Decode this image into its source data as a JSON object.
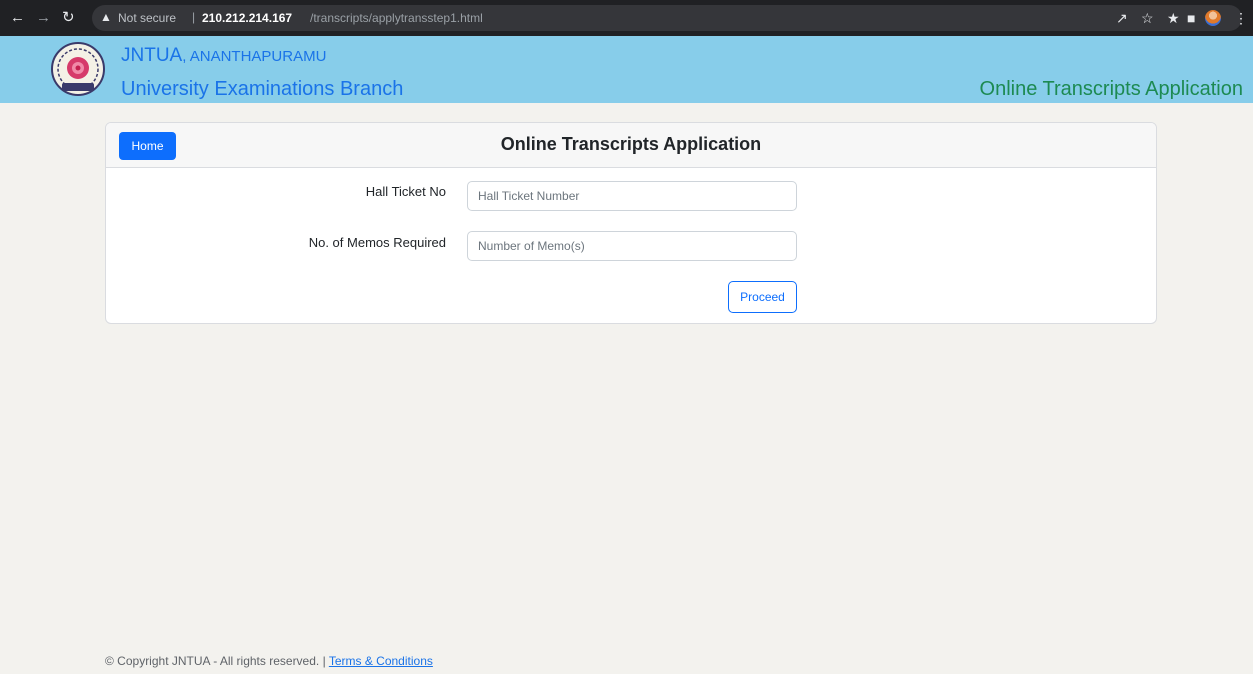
{
  "browser": {
    "not_secure": "Not secure",
    "separator": "|",
    "host": "210.212.214.167",
    "path": "/transcripts/applytransstep1.html"
  },
  "header": {
    "brand_name": "JNTUA",
    "brand_city": ", ANANTHAPURAMU",
    "branch": "University Examinations Branch",
    "app_title": "Online Transcripts Application"
  },
  "card": {
    "home_label": "Home",
    "title": "Online Transcripts Application",
    "hall_ticket_label": "Hall Ticket No",
    "hall_ticket_placeholder": "Hall Ticket Number",
    "hall_ticket_value": "",
    "memos_label": "No. of Memos Required",
    "memos_placeholder": "Number of Memo(s)",
    "memos_value": "",
    "proceed_label": "Proceed"
  },
  "footer": {
    "copyright": "© Copyright JNTUA - All rights reserved. |",
    "terms_label": "Terms & Conditions"
  },
  "colors": {
    "header_bg": "#87cdea",
    "brand_blue": "#1a73e8",
    "app_title_green": "#1d8a52",
    "primary": "#0d6efd"
  }
}
